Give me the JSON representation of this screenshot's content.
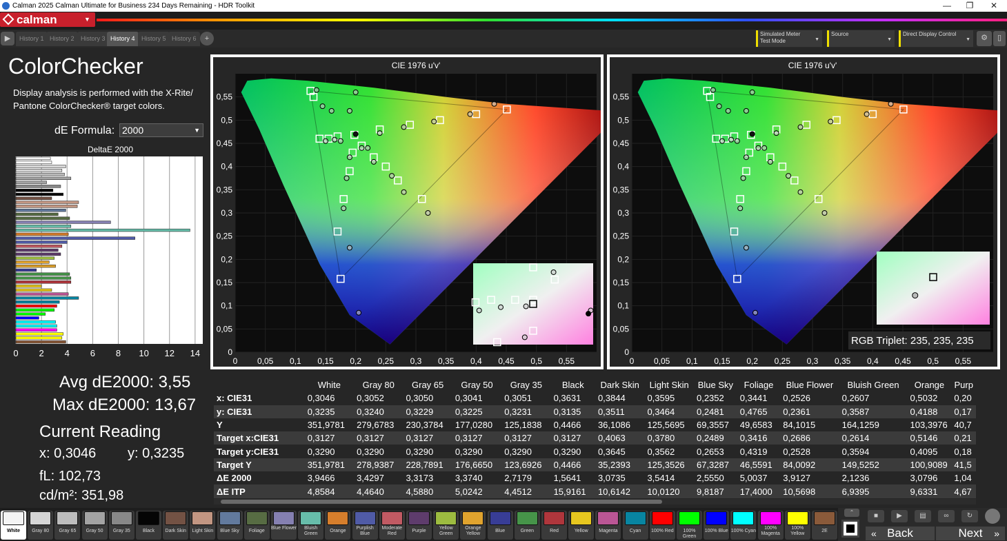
{
  "window": {
    "title": "Calman 2025 Calman Ultimate for Business 234 Days Remaining  - HDR Toolkit",
    "minimize": "—",
    "restore": "❐",
    "close": "✕"
  },
  "brand": {
    "logo": "calman",
    "accent": "#c8202c"
  },
  "tabs": [
    "History 1",
    "History 2",
    "History 3",
    "History 4",
    "History 5",
    "History 6"
  ],
  "active_tab": "History 4",
  "dropdowns": {
    "meter": {
      "line1": "Simulated Meter",
      "line2": "Test Mode"
    },
    "source": {
      "line1": "Source"
    },
    "display": {
      "line1": "Direct Display Control"
    }
  },
  "left": {
    "title": "ColorChecker",
    "description": "Display analysis is performed with the X-Rite/ Pantone ColorChecker® target colors.",
    "formula_label": "dE Formula:",
    "formula_value": "2000",
    "bar_title": "DeltaE 2000",
    "avg": "Avg dE2000: 3,55",
    "max": "Max dE2000: 13,67",
    "current_reading": "Current Reading",
    "x": "x: 0,3046",
    "y": "y: 0,3235",
    "fl": "fL: 102,73",
    "cdm": "cd/m²: 351,98"
  },
  "deltae_axis": [
    "0",
    "2",
    "4",
    "6",
    "8",
    "10",
    "12",
    "14"
  ],
  "plot1": {
    "title": "CIE 1976 u'v'"
  },
  "plot2": {
    "title": "CIE 1976 u'v'",
    "rgb_triplet": "RGB Triplet: 235, 235, 235"
  },
  "plot_xticks": [
    "0",
    "0,05",
    "0,1",
    "0,15",
    "0,2",
    "0,25",
    "0,3",
    "0,35",
    "0,4",
    "0,45",
    "0,5",
    "0,55"
  ],
  "plot_yticks": [
    "0,55",
    "0,5",
    "0,45",
    "0,4",
    "0,35",
    "0,3",
    "0,25",
    "0,2",
    "0,15",
    "0,1",
    "0,05",
    "0"
  ],
  "table": {
    "columns": [
      "",
      "White",
      "Gray 80",
      "Gray 65",
      "Gray 50",
      "Gray 35",
      "Black",
      "Dark Skin",
      "Light Skin",
      "Blue Sky",
      "Foliage",
      "Blue Flower",
      "Bluish Green",
      "Orange",
      "Purp"
    ],
    "rows": [
      [
        "x: CIE31",
        "0,3046",
        "0,3052",
        "0,3050",
        "0,3041",
        "0,3051",
        "0,3631",
        "0,3844",
        "0,3595",
        "0,2352",
        "0,3441",
        "0,2526",
        "0,2607",
        "0,5032",
        "0,20"
      ],
      [
        "y: CIE31",
        "0,3235",
        "0,3240",
        "0,3229",
        "0,3225",
        "0,3231",
        "0,3135",
        "0,3511",
        "0,3464",
        "0,2481",
        "0,4765",
        "0,2361",
        "0,3587",
        "0,4188",
        "0,17"
      ],
      [
        "Y",
        "351,9781",
        "279,6783",
        "230,3784",
        "177,0280",
        "125,1838",
        "0,4466",
        "36,1086",
        "125,5695",
        "69,3557",
        "49,6583",
        "84,1015",
        "164,1259",
        "103,3976",
        "40,7"
      ],
      [
        "Target x:CIE31",
        "0,3127",
        "0,3127",
        "0,3127",
        "0,3127",
        "0,3127",
        "0,3127",
        "0,4063",
        "0,3780",
        "0,2489",
        "0,3416",
        "0,2686",
        "0,2614",
        "0,5146",
        "0,21"
      ],
      [
        "Target y:CIE31",
        "0,3290",
        "0,3290",
        "0,3290",
        "0,3290",
        "0,3290",
        "0,3290",
        "0,3645",
        "0,3562",
        "0,2653",
        "0,4319",
        "0,2528",
        "0,3594",
        "0,4095",
        "0,18"
      ],
      [
        "Target Y",
        "351,9781",
        "278,9387",
        "228,7891",
        "176,6650",
        "123,6926",
        "0,4466",
        "35,2393",
        "125,3526",
        "67,3287",
        "46,5591",
        "84,0092",
        "149,5252",
        "100,9089",
        "41,5"
      ],
      [
        "ΔE 2000",
        "3,9466",
        "3,4297",
        "3,3173",
        "3,3740",
        "2,7179",
        "1,5641",
        "3,0735",
        "3,5414",
        "2,5550",
        "5,0037",
        "3,9127",
        "2,1236",
        "3,0796",
        "1,04"
      ],
      [
        "ΔE ITP",
        "4,8584",
        "4,4640",
        "4,5880",
        "5,0242",
        "4,4512",
        "15,9161",
        "10,6142",
        "10,0120",
        "9,8187",
        "17,4000",
        "10,5698",
        "6,9395",
        "9,6331",
        "4,67"
      ]
    ]
  },
  "swatches": [
    {
      "label": "White",
      "color": "#f4f4f4"
    },
    {
      "label": "Gray 80",
      "color": "#d6d6d6"
    },
    {
      "label": "Gray 65",
      "color": "#bdbdbd"
    },
    {
      "label": "Gray 50",
      "color": "#a3a3a3"
    },
    {
      "label": "Gray 35",
      "color": "#888888"
    },
    {
      "label": "Black",
      "color": "#050505"
    },
    {
      "label": "Dark Skin",
      "color": "#735244"
    },
    {
      "label": "Light Skin",
      "color": "#c29682"
    },
    {
      "label": "Blue Sky",
      "color": "#627a9d"
    },
    {
      "label": "Foliage",
      "color": "#576c43"
    },
    {
      "label": "Blue Flower",
      "color": "#8580b1"
    },
    {
      "label": "Bluish Green",
      "color": "#67bdaa"
    },
    {
      "label": "Orange",
      "color": "#d67e2c"
    },
    {
      "label": "Purplish Blue",
      "color": "#505ba6"
    },
    {
      "label": "Moderate Red",
      "color": "#c15a63"
    },
    {
      "label": "Purple",
      "color": "#5e3c6c"
    },
    {
      "label": "Yellow Green",
      "color": "#9dbc40"
    },
    {
      "label": "Orange Yellow",
      "color": "#e0a32e"
    },
    {
      "label": "Blue",
      "color": "#383d96"
    },
    {
      "label": "Green",
      "color": "#469449"
    },
    {
      "label": "Red",
      "color": "#af363c"
    },
    {
      "label": "Yellow",
      "color": "#e7c71f"
    },
    {
      "label": "Magenta",
      "color": "#bb5695"
    },
    {
      "label": "Cyan",
      "color": "#0885a1"
    },
    {
      "label": "100% Red",
      "color": "#ff0000"
    },
    {
      "label": "100% Green",
      "color": "#00ff00"
    },
    {
      "label": "100% Blue",
      "color": "#0000ff"
    },
    {
      "label": "100% Cyan",
      "color": "#00ffff"
    },
    {
      "label": "100% Magenta",
      "color": "#ff00ff"
    },
    {
      "label": "100% Yellow",
      "color": "#ffff00"
    },
    {
      "label": "2E",
      "color": "#8a5a3a"
    }
  ],
  "nav": {
    "back": "Back",
    "next": "Next"
  }
}
